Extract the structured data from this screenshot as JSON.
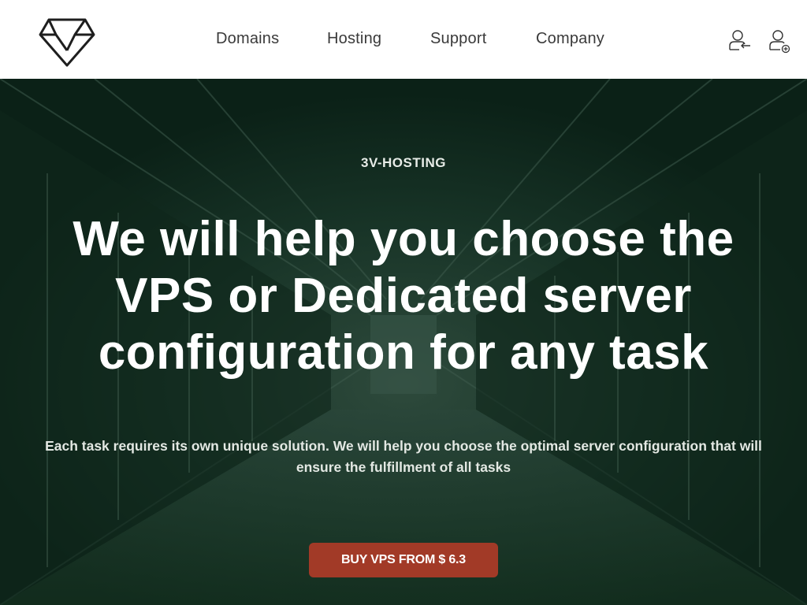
{
  "header": {
    "logo_icon": "diamond-logo-icon",
    "nav": [
      {
        "label": "Domains"
      },
      {
        "label": "Hosting"
      },
      {
        "label": "Support"
      },
      {
        "label": "Company"
      }
    ],
    "actions": [
      {
        "icon": "user-login-icon"
      },
      {
        "icon": "user-register-icon"
      }
    ]
  },
  "hero": {
    "eyebrow": "3V-HOSTING",
    "title": "We will help you choose the VPS or Dedicated server configuration for any task",
    "subtitle": "Each task requires its own unique solution. We will help you choose the optimal server configuration that will ensure the fulfillment of all tasks",
    "cta_label": "BUY VPS FROM $ 6.3"
  },
  "colors": {
    "header_bg": "#ffffff",
    "nav_text": "#3a3a3a",
    "hero_overlay": "#0e2a1e",
    "cta_bg": "#a23a27",
    "cta_text": "#ffffff"
  }
}
